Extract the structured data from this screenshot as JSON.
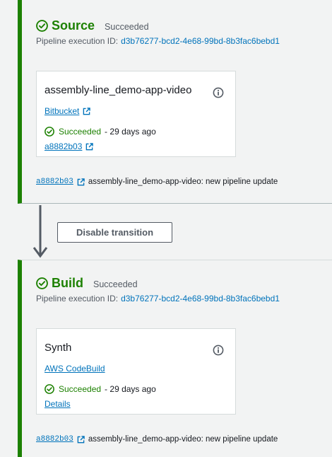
{
  "colors": {
    "success": "#1d8102",
    "link": "#0073bb",
    "muted": "#545b64",
    "background": "#f2f3f3"
  },
  "stages": {
    "source": {
      "title": "Source",
      "status": "Succeeded",
      "execution_label": "Pipeline execution ID:",
      "execution_id": "d3b76277-bcd2-4e68-99bd-8b3fac6bebd1",
      "action": {
        "name": "assembly-line_demo-app-video",
        "provider": "Bitbucket",
        "status": "Succeeded",
        "time": "29 days ago",
        "link": "a8882b03"
      },
      "commit": {
        "hash": "a8882b03",
        "message": "assembly-line_demo-app-video: new pipeline update"
      }
    },
    "transition": {
      "button_label": "Disable transition"
    },
    "build": {
      "title": "Build",
      "status": "Succeeded",
      "execution_label": "Pipeline execution ID:",
      "execution_id": "d3b76277-bcd2-4e68-99bd-8b3fac6bebd1",
      "action": {
        "name": "Synth",
        "provider": "AWS CodeBuild",
        "status": "Succeeded",
        "time": "29 days ago",
        "link": "Details"
      },
      "commit": {
        "hash": "a8882b03",
        "message": "assembly-line_demo-app-video: new pipeline update"
      }
    }
  }
}
